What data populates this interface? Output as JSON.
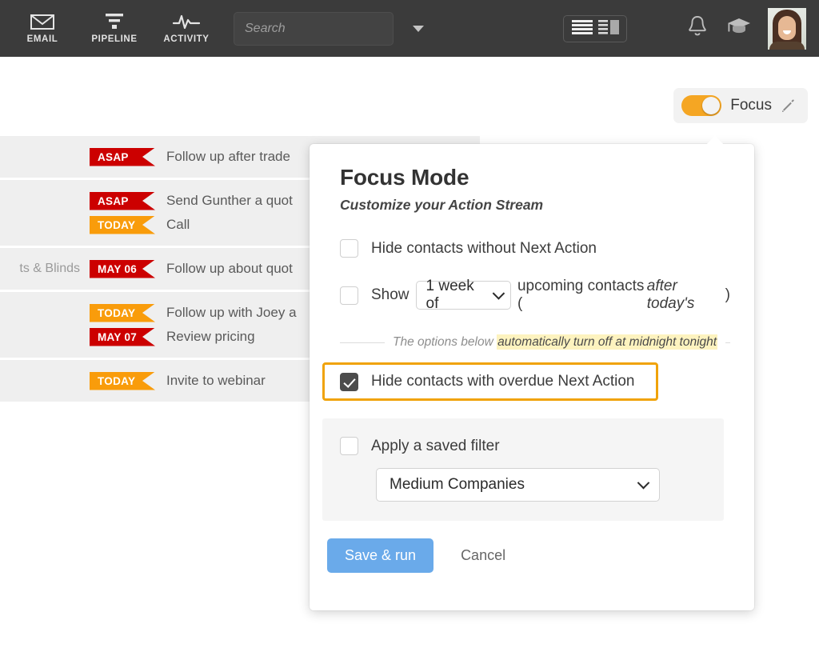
{
  "topnav": {
    "items": [
      {
        "label": "EMAIL",
        "icon": "email-icon"
      },
      {
        "label": "PIPELINE",
        "icon": "pipeline-funnel-icon"
      },
      {
        "label": "ACTIVITY",
        "icon": "activity-pulse-icon"
      }
    ],
    "search": {
      "placeholder": "Search",
      "value": ""
    },
    "view_toggle_icon": "list-split-view-icon",
    "notifications_icon": "bell-icon",
    "learning_icon": "graduation-cap-icon",
    "avatar_icon": "user-avatar"
  },
  "focus_pill": {
    "label": "Focus",
    "toggle_state": "on",
    "edit_icon": "pencil-icon",
    "accent_color": "#f5a623"
  },
  "stream": {
    "rows": [
      {
        "company": "",
        "lines": [
          {
            "badge": "ASAP",
            "badge_type": "asap",
            "task": "Follow up after trade"
          }
        ]
      },
      {
        "company": "",
        "lines": [
          {
            "badge": "ASAP",
            "badge_type": "asap",
            "task": "Send Gunther a quot"
          },
          {
            "badge": "TODAY",
            "badge_type": "today",
            "task": "Call"
          }
        ]
      },
      {
        "company": "ts & Blinds",
        "lines": [
          {
            "badge": "MAY 06",
            "badge_type": "date",
            "task": "Follow up about quot"
          }
        ]
      },
      {
        "company": "",
        "lines": [
          {
            "badge": "TODAY",
            "badge_type": "today",
            "task": "Follow up with Joey a"
          },
          {
            "badge": "MAY 07",
            "badge_type": "date",
            "task": "Review pricing"
          }
        ]
      },
      {
        "company": "",
        "lines": [
          {
            "badge": "TODAY",
            "badge_type": "today",
            "task": "Invite to webinar"
          }
        ]
      }
    ],
    "badge_colors": {
      "asap": "#cc0000",
      "date": "#cc0000",
      "today": "#f99c0b"
    }
  },
  "popover": {
    "title": "Focus Mode",
    "subtitle": "Customize your Action Stream",
    "option_hide_no_next_action": {
      "label": "Hide contacts without Next Action",
      "checked": false
    },
    "option_show_upcoming": {
      "prefix": "Show",
      "select_value": "1 week of",
      "suffix": "upcoming contacts (",
      "suffix_italic": "after today's",
      "suffix_end": ")",
      "checked": false
    },
    "divider": {
      "text_plain": "The options below ",
      "text_highlighted": "automatically turn off at midnight tonight",
      "highlight_color": "#fdf3bf"
    },
    "option_hide_overdue": {
      "label": "Hide contacts with overdue Next Action",
      "checked": true,
      "outline_color": "#f0a30a"
    },
    "option_saved_filter": {
      "label": "Apply a saved filter",
      "checked": false
    },
    "saved_filter_select": {
      "value": "Medium Companies"
    },
    "buttons": {
      "save": "Save & run",
      "cancel": "Cancel",
      "save_color": "#6aaaea"
    }
  }
}
